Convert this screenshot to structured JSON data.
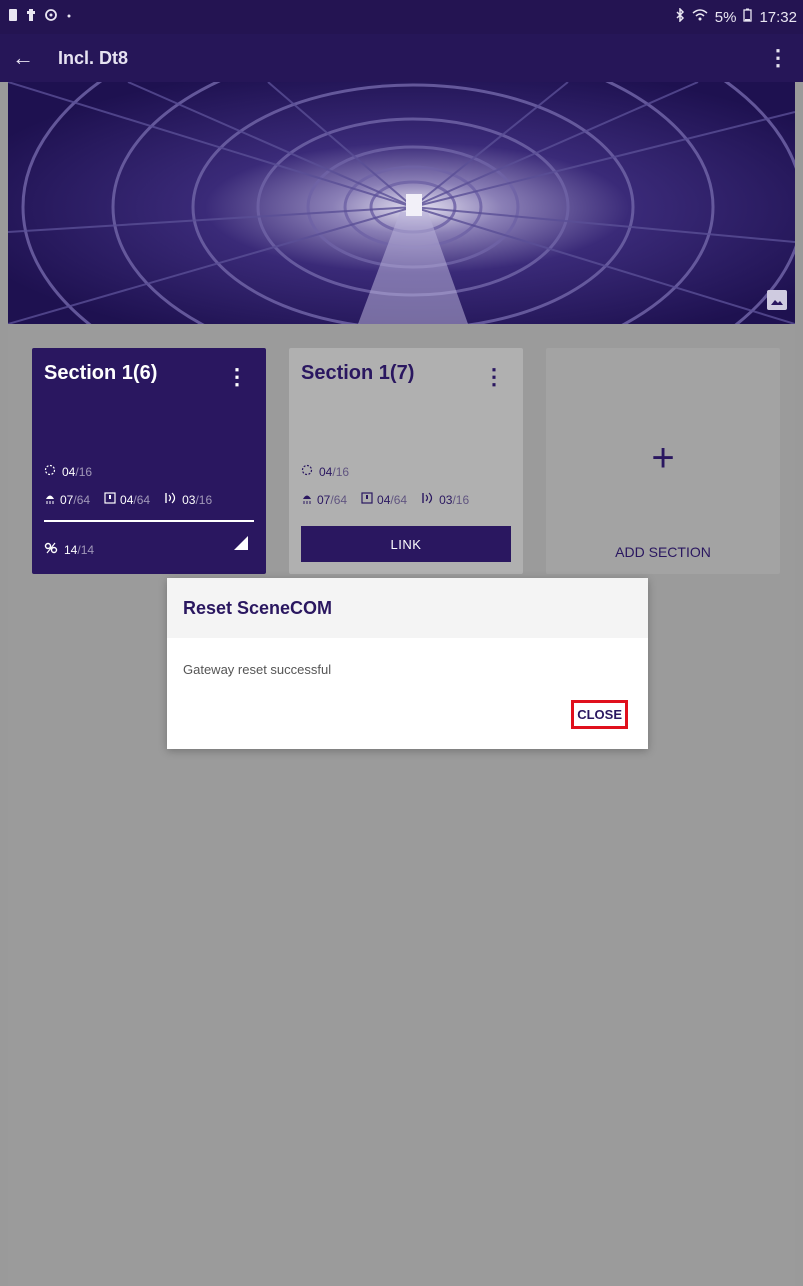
{
  "status_bar": {
    "right_text": "5%",
    "time": "17:32"
  },
  "toolbar": {
    "title": "Incl. Dt8"
  },
  "cards": [
    {
      "name": "Section 1(6)",
      "scenes": {
        "value": "04",
        "total": "/16"
      },
      "lights": {
        "value": "07",
        "total": "/64"
      },
      "switches": {
        "value": "04",
        "total": "/64"
      },
      "sensors": {
        "value": "03",
        "total": "/16"
      },
      "links": {
        "value": "14",
        "total": "/14"
      }
    },
    {
      "name": "Section 1(7)",
      "scenes": {
        "value": "04",
        "total": "/16"
      },
      "lights": {
        "value": "07",
        "total": "/64"
      },
      "switches": {
        "value": "04",
        "total": "/64"
      },
      "sensors": {
        "value": "03",
        "total": "/16"
      },
      "link_button": "LINK"
    }
  ],
  "add_section": {
    "plus": "+",
    "label": "ADD SECTION"
  },
  "dialog": {
    "title": "Reset SceneCOM",
    "message": "Gateway reset successful",
    "close_label": "CLOSE"
  },
  "colors": {
    "primary": "#2a1760",
    "status_bar": "#241452",
    "highlight": "#e0101c",
    "scrim": "#9b9b9b"
  }
}
